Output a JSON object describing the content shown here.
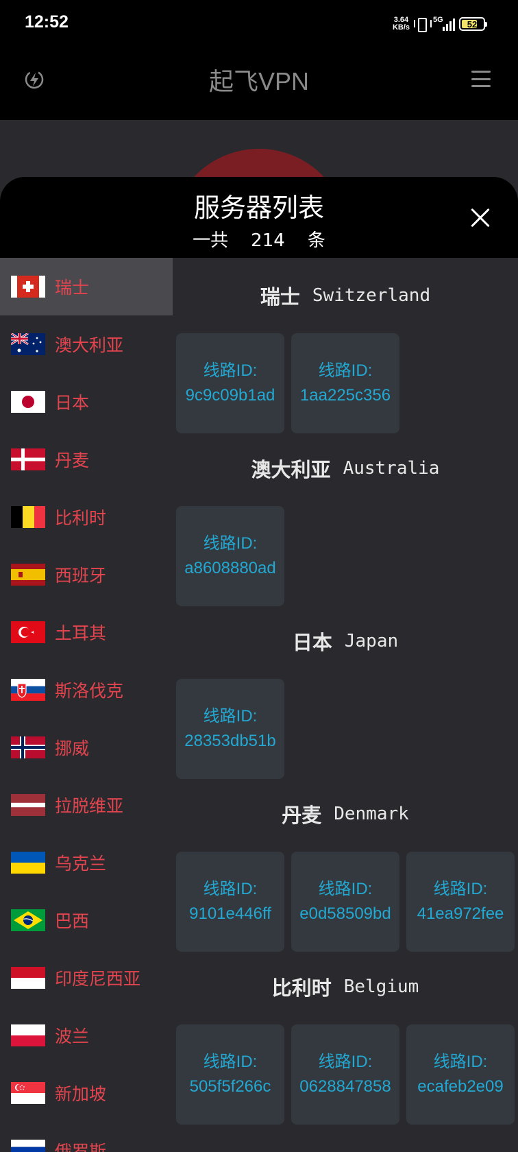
{
  "status_bar": {
    "time": "12:52",
    "net_speed_value": "3.64",
    "net_speed_unit": "KB/s",
    "network": "5G",
    "battery_level": "52"
  },
  "app": {
    "title": "起飞VPN",
    "icons": {
      "left": "bolt-circle-icon",
      "right": "hamburger-menu-icon"
    }
  },
  "sheet": {
    "title": "服务器列表",
    "count_prefix": "一共",
    "count": "214",
    "count_suffix": "条",
    "close_icon": "close-icon"
  },
  "sidebar": {
    "items": [
      {
        "label": "瑞士",
        "flag": "switzerland",
        "active": true
      },
      {
        "label": "澳大利亚",
        "flag": "australia"
      },
      {
        "label": "日本",
        "flag": "japan"
      },
      {
        "label": "丹麦",
        "flag": "denmark"
      },
      {
        "label": "比利时",
        "flag": "belgium"
      },
      {
        "label": "西班牙",
        "flag": "spain"
      },
      {
        "label": "土耳其",
        "flag": "turkey"
      },
      {
        "label": "斯洛伐克",
        "flag": "slovakia"
      },
      {
        "label": "挪威",
        "flag": "norway"
      },
      {
        "label": "拉脱维亚",
        "flag": "latvia"
      },
      {
        "label": "乌克兰",
        "flag": "ukraine"
      },
      {
        "label": "巴西",
        "flag": "brazil"
      },
      {
        "label": "印度尼西亚",
        "flag": "indonesia"
      },
      {
        "label": "波兰",
        "flag": "poland"
      },
      {
        "label": "新加坡",
        "flag": "singapore"
      },
      {
        "label": "俄罗斯",
        "flag": "russia"
      }
    ]
  },
  "sections": [
    {
      "name_cn": "瑞士",
      "name_en": "Switzerland",
      "lines": [
        {
          "label": "线路ID:",
          "id": "9c9c09b1ad"
        },
        {
          "label": "线路ID:",
          "id": "1aa225c356"
        }
      ]
    },
    {
      "name_cn": "澳大利亚",
      "name_en": "Australia",
      "lines": [
        {
          "label": "线路ID:",
          "id": "a8608880ad"
        }
      ]
    },
    {
      "name_cn": "日本",
      "name_en": "Japan",
      "lines": [
        {
          "label": "线路ID:",
          "id": "28353db51b"
        }
      ]
    },
    {
      "name_cn": "丹麦",
      "name_en": "Denmark",
      "lines": [
        {
          "label": "线路ID:",
          "id": "9101e446ff"
        },
        {
          "label": "线路ID:",
          "id": "e0d58509bd"
        },
        {
          "label": "线路ID:",
          "id": "41ea972fee"
        }
      ]
    },
    {
      "name_cn": "比利时",
      "name_en": "Belgium",
      "lines": [
        {
          "label": "线路ID:",
          "id": "505f5f266c"
        },
        {
          "label": "线路ID:",
          "id": "0628847858"
        },
        {
          "label": "线路ID:",
          "id": "ecafeb2e09"
        }
      ]
    }
  ],
  "colors": {
    "accent_red": "#e3444e",
    "line_id_blue": "#22a8d2",
    "card_bg": "#33393e",
    "panel_bg": "#2a2a2e",
    "active_item_bg": "#4a4a4e"
  }
}
